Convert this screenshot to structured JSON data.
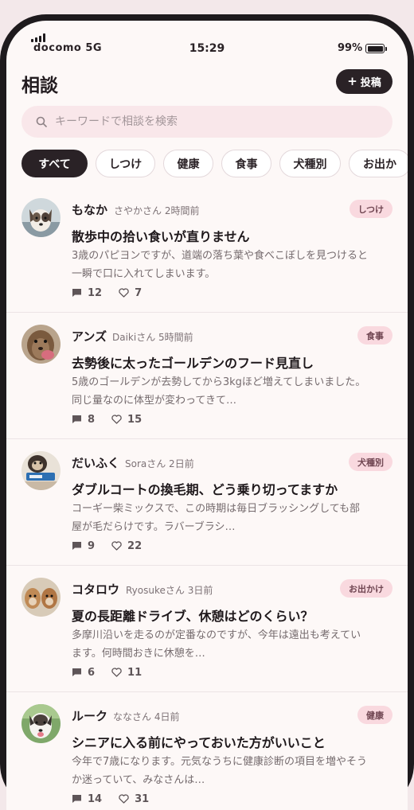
{
  "status_bar": {
    "carrier": "docomo  5G",
    "time": "15:29",
    "battery": "99%"
  },
  "header": {
    "title": "相談",
    "post_button": "投稿"
  },
  "search": {
    "placeholder": "キーワードで相談を検索"
  },
  "categories": [
    {
      "label": "すべて",
      "active": true
    },
    {
      "label": "しつけ",
      "active": false
    },
    {
      "label": "健康",
      "active": false
    },
    {
      "label": "食事",
      "active": false
    },
    {
      "label": "犬種別",
      "active": false
    },
    {
      "label": "お出か",
      "active": false
    }
  ],
  "posts": [
    {
      "dog": "もなか",
      "meta": "さやかさん 2時間前",
      "tag": "しつけ",
      "title": "散歩中の拾い食いが直りません",
      "excerpt_1": "3歳のパピヨンですが、道端の落ち葉や食べこぼしを見つけると",
      "excerpt_2": "一瞬で口に入れてしまいます。",
      "comments": "12",
      "likes": "7"
    },
    {
      "dog": "アンズ",
      "meta": "Daikiさん 5時間前",
      "tag": "食事",
      "title": "去勢後に太ったゴールデンのフード見直し",
      "excerpt_1": "5歳のゴールデンが去勢してから3kgほど増えてしまいました。",
      "excerpt_2": "同じ量なのに体型が変わってきて…",
      "comments": "8",
      "likes": "15"
    },
    {
      "dog": "だいふく",
      "meta": "Soraさん 2日前",
      "tag": "犬種別",
      "title": "ダブルコートの換毛期、どう乗り切ってますか",
      "excerpt_1": "コーギー柴ミックスで、この時期は毎日ブラッシングしても部",
      "excerpt_2": "屋が毛だらけです。ラバーブラシ…",
      "comments": "9",
      "likes": "22"
    },
    {
      "dog": "コタロウ",
      "meta": "Ryosukeさん 3日前",
      "tag": "お出かけ",
      "title": "夏の長距離ドライブ、休憩はどのくらい？",
      "excerpt_1": "多摩川沿いを走るのが定番なのですが、今年は遠出も考えてい",
      "excerpt_2": "ます。何時間おきに休憩を…",
      "comments": "6",
      "likes": "11"
    },
    {
      "dog": "ルーク",
      "meta": "ななさん 4日前",
      "tag": "健康",
      "title": "シニアに入る前にやっておいた方がいいこと",
      "excerpt_1": "今年で7歳になります。元気なうちに健康診断の項目を増やそう",
      "excerpt_2": "か迷っていて、みなさんは…",
      "comments": "14",
      "likes": "31"
    }
  ],
  "colors": {
    "accent_dark": "#2a2226",
    "tag_bg": "#f9d9df",
    "search_bg": "#f9e7ea",
    "background": "#fdf8f7"
  },
  "icons": {
    "comment": "comment-icon",
    "like": "heart-icon",
    "search": "search-icon",
    "signal": "signal-icon",
    "battery": "battery-icon"
  }
}
